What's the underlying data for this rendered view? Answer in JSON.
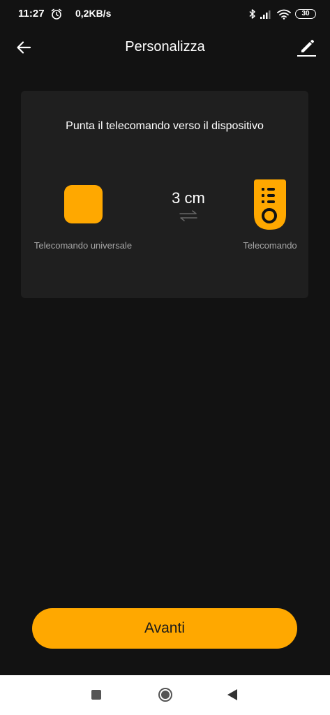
{
  "status_bar": {
    "time": "11:27",
    "speed": "0,2KB/s",
    "battery": "30",
    "icons": [
      "alarm-icon",
      "bluetooth-icon",
      "signal-icon",
      "wifi-icon",
      "battery-icon"
    ]
  },
  "header": {
    "title": "Personalizza",
    "icons": [
      "back-arrow-icon",
      "edit-pencil-icon"
    ]
  },
  "card": {
    "instruction": "Punta il telecomando verso il dispositivo",
    "left_device_label": "Telecomando universale",
    "distance": "3 cm",
    "right_device_label": "Telecomando",
    "icons": [
      "universal-remote-icon",
      "swap-arrows-icon",
      "remote-control-icon"
    ]
  },
  "primary_button": {
    "label": "Avanti"
  },
  "nav_bar": {
    "icons": [
      "recents-square-icon",
      "home-circle-icon",
      "back-triangle-icon"
    ]
  },
  "colors": {
    "background": "#121212",
    "card": "#1f1f1f",
    "accent": "#ffa800",
    "secondary_text": "#a6a6a6"
  }
}
